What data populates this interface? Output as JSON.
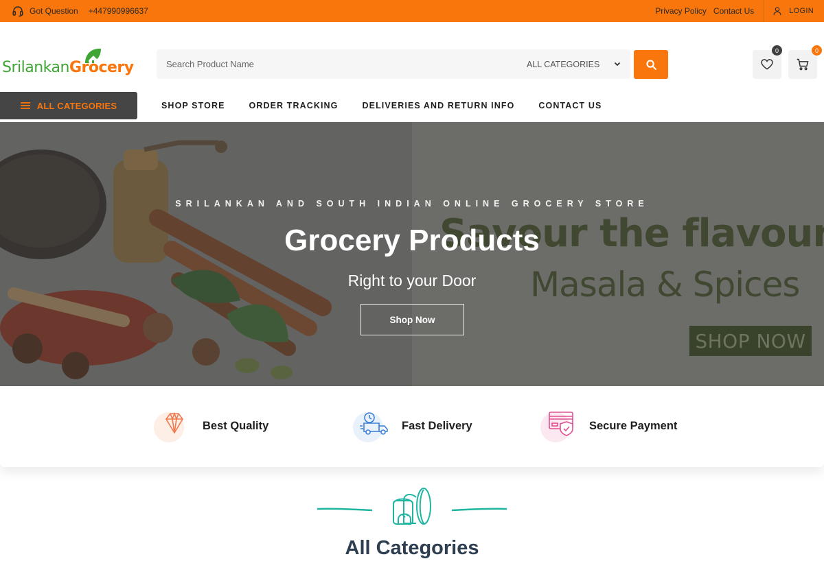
{
  "topbar": {
    "question_label": "Got Question",
    "phone": "+447990996637",
    "links": [
      "Privacy Policy",
      "Contact Us"
    ],
    "login_label": "LOGIN",
    "bg_color": "#f8760c"
  },
  "header": {
    "logo": {
      "part1": "Srilankan",
      "part2": "Grocery"
    },
    "search": {
      "placeholder": "Search Product Name",
      "category": "ALL CATEGORIES"
    },
    "wishlist_count": "0",
    "cart_count": "0"
  },
  "nav": {
    "all_categories_label": "ALL CATEGORIES",
    "items": [
      "SHOP STORE",
      "ORDER TRACKING",
      "DELIVERIES AND RETURN INFO",
      "CONTACT US"
    ]
  },
  "hero": {
    "tagline": "SRILANKAN AND SOUTH INDIAN ONLINE GROCERY STORE",
    "title": "Grocery Products",
    "subtitle": "Right to your Door",
    "button_label": "Shop Now",
    "promo_line1": "Savour the flavours",
    "promo_line2": "Masala & Spices",
    "promo_button": "SHOP NOW"
  },
  "features": [
    {
      "label": "Best Quality",
      "icon": "diamond-icon",
      "color": "#f07a4d"
    },
    {
      "label": "Fast Delivery",
      "icon": "delivery-truck-icon",
      "color": "#3b7fd4"
    },
    {
      "label": "Secure Payment",
      "icon": "secure-card-icon",
      "color": "#e0508f"
    }
  ],
  "section": {
    "title": "All Categories",
    "icon": "bread-icon",
    "accent": "#1fb5a0"
  }
}
